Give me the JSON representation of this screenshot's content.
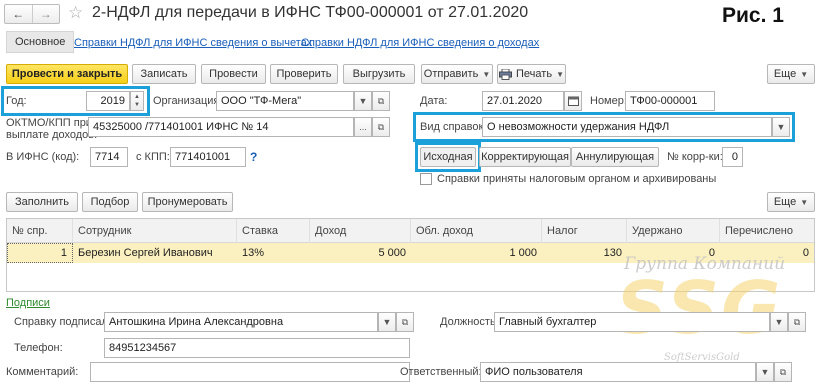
{
  "window": {
    "title": "2-НДФЛ для передачи в ИФНС ТФ00-000001 от 27.01.2020",
    "fig_label": "Рис. 1"
  },
  "tabs": {
    "main": "Основное",
    "deductions": "Справки НДФЛ для ИФНС сведения о вычетах",
    "income": "Справки НДФЛ для ИФНС сведения о доходах"
  },
  "toolbar": {
    "post_close": "Провести и закрыть",
    "save": "Записать",
    "post": "Провести",
    "check": "Проверить",
    "upload": "Выгрузить",
    "send": "Отправить",
    "print": "Печать",
    "more": "Еще"
  },
  "form": {
    "year_label": "Год:",
    "year_value": "2019",
    "org_label": "Организация:",
    "org_value": "ООО \"ТФ-Мега\"",
    "date_label": "Дата:",
    "date_value": "27.01.2020",
    "number_label": "Номер:",
    "number_value": "ТФ00-000001",
    "oktmo_label_1": "ОКТМО/КПП при",
    "oktmo_label_2": "выплате доходов:",
    "oktmo_value": "45325000   /771401001 ИФНС № 14",
    "type_label": "Вид справок:",
    "type_value": "О невозможности удержания НДФЛ",
    "ifns_label": "В ИФНС (код):",
    "ifns_value": "7714",
    "kpp_label": "с КПП:",
    "kpp_value": "771401001",
    "help": "?",
    "seg_initial": "Исходная",
    "seg_corrective": "Корректирующая",
    "seg_cancel": "Аннулирующая",
    "corr_label": "№ корр-ки:",
    "corr_value": "0",
    "accepted_label": "Справки приняты налоговым органом и архивированы"
  },
  "table_toolbar": {
    "fill": "Заполнить",
    "select": "Подбор",
    "renumber": "Пронумеровать",
    "more": "Еще"
  },
  "table": {
    "headers": [
      "№ спр.",
      "Сотрудник",
      "Ставка",
      "Доход",
      "Обл. доход",
      "Налог",
      "Удержано",
      "Перечислено"
    ],
    "rows": [
      {
        "num": "1",
        "employee": "Березин Сергей Иванович",
        "rate": "13%",
        "income": "5 000",
        "taxable": "1 000",
        "tax": "130",
        "withheld": "0",
        "transferred": "0"
      }
    ]
  },
  "signatures": {
    "title": "Подписи",
    "signed_label": "Справку подписал:",
    "signed_value": "Антошкина Ирина Александровна",
    "position_label": "Должность:",
    "position_value": "Главный бухгалтер",
    "phone_label": "Телефон:",
    "phone_value": "84951234567",
    "comment_label": "Комментарий:",
    "comment_value": "",
    "responsible_label": "Ответственный:",
    "responsible_value": "ФИО пользователя"
  },
  "watermark": {
    "line1": "Группа Компаний",
    "logo": "SSG",
    "site": "SoftServisGold"
  },
  "icons": {
    "back": "back-arrow-icon",
    "forward": "forward-arrow-icon",
    "star": "star-icon",
    "print": "printer-icon",
    "calendar": "calendar-icon"
  },
  "colors": {
    "highlight": "#1ba0d9",
    "primary_button": "#f6cf17",
    "selected_row": "#fbf0bf",
    "link": "#1a5eb8"
  }
}
